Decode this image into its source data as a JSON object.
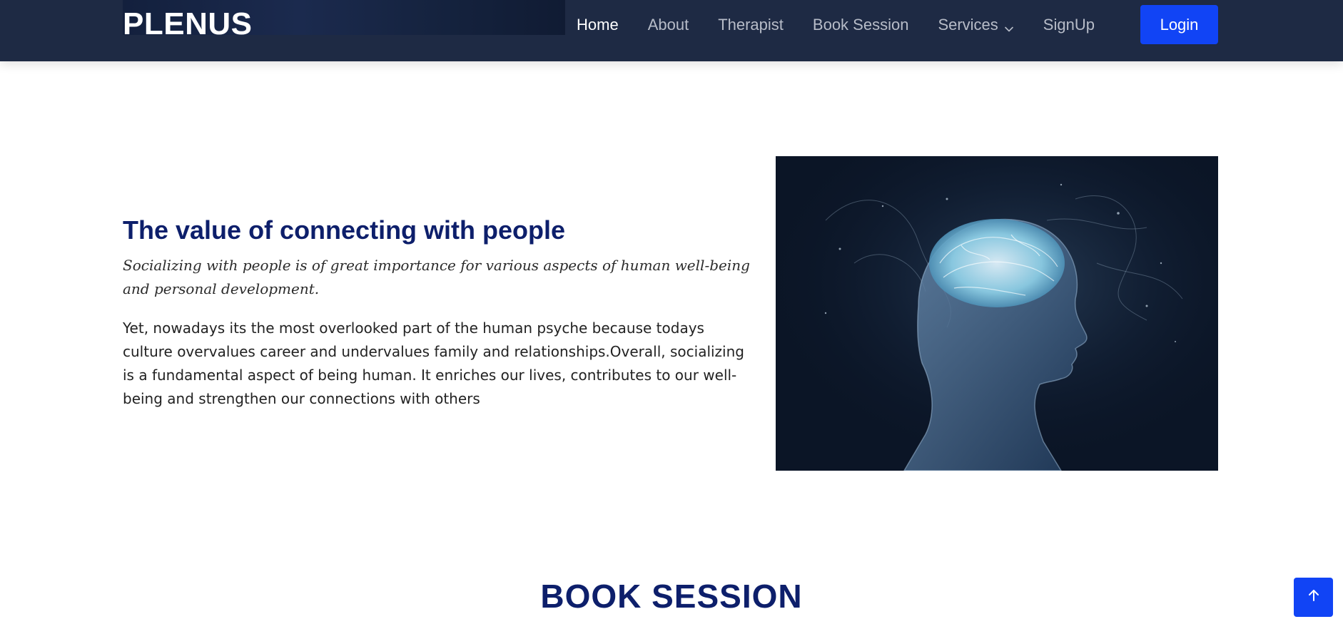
{
  "brand": {
    "name": "PLENUS"
  },
  "nav": {
    "items": [
      {
        "label": "Home",
        "active": true
      },
      {
        "label": "About",
        "active": false
      },
      {
        "label": "Therapist",
        "active": false
      },
      {
        "label": "Book Session",
        "active": false
      },
      {
        "label": "Services",
        "active": false,
        "icon": "chevron-down-icon"
      },
      {
        "label": "SignUp",
        "active": false
      }
    ],
    "login_label": "Login"
  },
  "about": {
    "heading": "The value of connecting with people",
    "lead": "Socializing with people is of great importance for various aspects of human well-being and personal development.",
    "body": "Yet, nowadays its the most overlooked part of the human psyche because todays culture overvalues career and undervalues family and relationships.Overall, socializing is a fundamental aspect of being human. It enriches our lives, contributes to our well-being and strengthen our connections with others"
  },
  "book_session": {
    "title": "BOOK SESSION"
  },
  "back_to_top": {
    "icon": "arrow-up-icon"
  },
  "colors": {
    "navbar_bg": "#1e2a44",
    "accent": "#1144f5",
    "heading": "#0d1f6b",
    "nav_inactive": "#b7bcc8",
    "nav_active": "#ffffff"
  }
}
